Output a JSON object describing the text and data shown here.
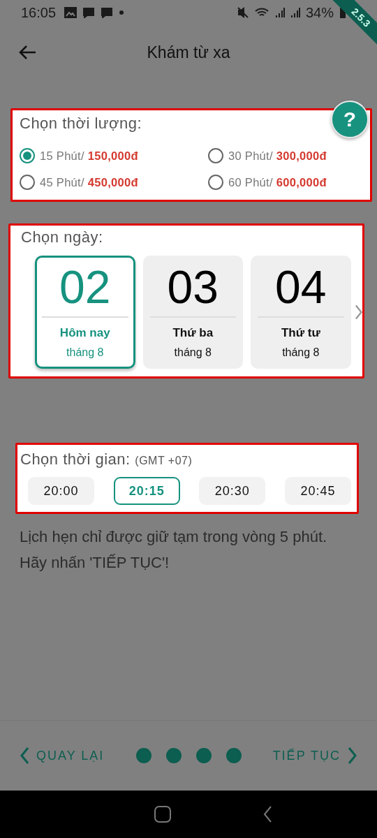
{
  "status_bar": {
    "time": "16:05",
    "battery": "34%"
  },
  "debug_banner": {
    "label": "2.5.3"
  },
  "app_bar": {
    "title": "Khám từ xa"
  },
  "help_button": {
    "label": "?"
  },
  "duration": {
    "title": "Chọn thời lượng:",
    "options": [
      {
        "duration": "15 Phút/",
        "price": "150,000đ",
        "selected": true
      },
      {
        "duration": "30 Phút/",
        "price": "300,000đ",
        "selected": false
      },
      {
        "duration": "45 Phút/",
        "price": "450,000đ",
        "selected": false
      },
      {
        "duration": "60 Phút/",
        "price": "600,000đ",
        "selected": false
      }
    ]
  },
  "date": {
    "title": "Chọn ngày:",
    "days": [
      {
        "day": "02",
        "weekday": "Hôm nay",
        "month": "tháng 8",
        "selected": true
      },
      {
        "day": "03",
        "weekday": "Thứ ba",
        "month": "tháng 8",
        "selected": false
      },
      {
        "day": "04",
        "weekday": "Thứ tư",
        "month": "tháng 8",
        "selected": false
      }
    ]
  },
  "time": {
    "title": "Chọn thời gian:",
    "timezone": "(GMT +07)",
    "slots": [
      {
        "label": "20:00",
        "selected": false
      },
      {
        "label": "20:15",
        "selected": true
      },
      {
        "label": "20:30",
        "selected": false
      },
      {
        "label": "20:45",
        "selected": false
      }
    ]
  },
  "note": "Lịch hẹn chỉ được giữ tạm trong vòng 5 phút. Hãy nhấn 'TIẾP TỤC'!",
  "footer": {
    "back": "QUAY LẠI",
    "next": "TIẾP TỤC",
    "steps": [
      {
        "filled": true
      },
      {
        "filled": true
      },
      {
        "filled": true
      },
      {
        "filled": true
      }
    ]
  }
}
